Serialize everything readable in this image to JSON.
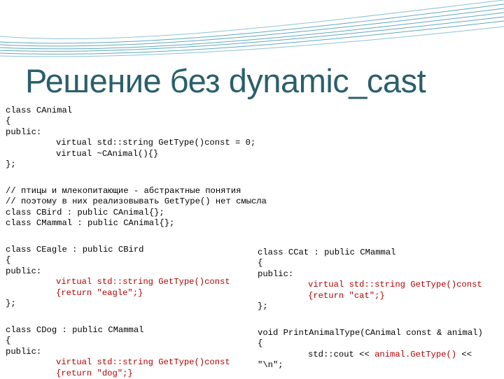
{
  "title": "Решение без dynamic_cast",
  "colors": {
    "title": "#2a5f6b",
    "decor_lines": "#5fa8bf",
    "highlight": "#b40000"
  },
  "code": {
    "decl": [
      "class CAnimal",
      "{",
      "public:",
      "virtual std::string GetType()const = 0;",
      "virtual ~CAnimal(){}",
      "};"
    ],
    "comments": [
      "// птицы и млекопитающие - абстрактные понятия",
      "// поэтому в них реализовывать GetType() нет смысла",
      "class CBird : public CAnimal{};",
      "class CMammal : public CAnimal{};"
    ],
    "eagle": [
      "class CEagle : public CBird",
      "{",
      "public:",
      "virtual std::string GetType()const",
      "{return \"eagle\";}",
      "};"
    ],
    "dog": [
      "class CDog : public CMammal",
      "{",
      "public:",
      "virtual std::string GetType()const",
      "{return \"dog\";}"
    ],
    "cat": [
      "class CCat : public CMammal",
      "{",
      "public:",
      "virtual std::string GetType()const",
      "{return \"cat\";}",
      "};"
    ],
    "print": {
      "line1": "void PrintAnimalType(CAnimal const & animal)",
      "line2": "{",
      "line3_prefix": "std::cout << ",
      "line3_highlight": "animal.GetType()",
      "line3_suffix": " <<",
      "line4": "\"\\n\";"
    }
  }
}
